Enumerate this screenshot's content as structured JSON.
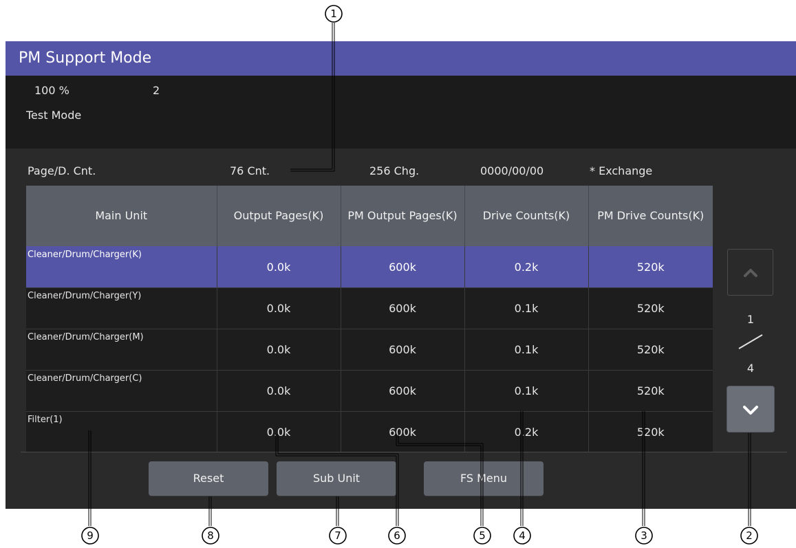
{
  "title": "PM Support Mode",
  "status": {
    "zoom": "100 %",
    "copies": "2",
    "mode": "Test Mode"
  },
  "info": {
    "label": "Page/D. Cnt.",
    "count": "76 Cnt.",
    "changes": "256 Chg.",
    "date": "0000/00/00",
    "exchange": "* Exchange"
  },
  "table": {
    "headers": [
      "Main Unit",
      "Output Pages(K)",
      "PM Output Pages(K)",
      "Drive Counts(K)",
      "PM Drive Counts(K)"
    ],
    "rows": [
      {
        "name": "Cleaner/Drum/Charger(K)",
        "output": "0.0k",
        "pm_output": "600k",
        "drive": "0.2k",
        "pm_drive": "520k",
        "selected": true
      },
      {
        "name": "Cleaner/Drum/Charger(Y)",
        "output": "0.0k",
        "pm_output": "600k",
        "drive": "0.1k",
        "pm_drive": "520k"
      },
      {
        "name": "Cleaner/Drum/Charger(M)",
        "output": "0.0k",
        "pm_output": "600k",
        "drive": "0.1k",
        "pm_drive": "520k"
      },
      {
        "name": "Cleaner/Drum/Charger(C)",
        "output": "0.0k",
        "pm_output": "600k",
        "drive": "0.1k",
        "pm_drive": "520k"
      },
      {
        "name": "Filter(1)",
        "output": "0.0k",
        "pm_output": "600k",
        "drive": "0.2k",
        "pm_drive": "520k"
      }
    ]
  },
  "pager": {
    "current": "1",
    "total": "4",
    "up_icon": "chevron-up-icon",
    "down_icon": "chevron-down-icon"
  },
  "buttons": {
    "reset": "Reset",
    "sub_unit": "Sub Unit",
    "fs_menu": "FS Menu"
  },
  "callouts": [
    "1",
    "2",
    "3",
    "4",
    "5",
    "6",
    "7",
    "8",
    "9"
  ],
  "colors": {
    "title_bar": "#5555a8",
    "selected_row": "#5555a8",
    "header_bg": "#5a5f68",
    "screen_bg": "#2a2a2a"
  }
}
